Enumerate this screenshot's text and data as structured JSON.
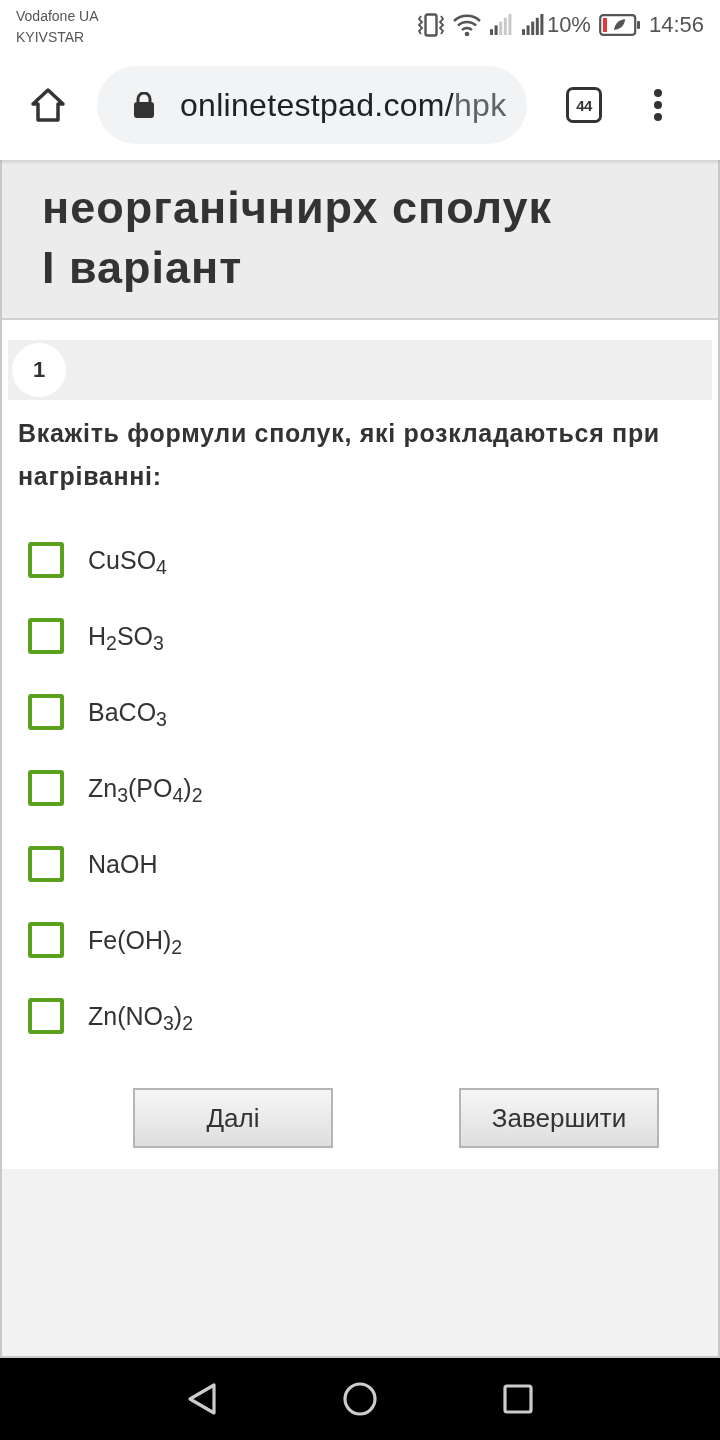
{
  "status_bar": {
    "carriers": [
      "Vodafone UA",
      "KYIVSTAR"
    ],
    "battery_text": "10%",
    "time": "14:56"
  },
  "browser": {
    "url_domain": "onlinetestpad.com/",
    "url_path": "hpk",
    "tab_count": "44"
  },
  "test": {
    "title_lines": [
      "неорганічнирх сполук",
      "І варіант"
    ],
    "question": {
      "number": "1",
      "text": "Вкажіть формули сполук, які розкладаються при нагріванні:",
      "options": [
        {
          "label": "CuSO$_{4}$",
          "checked": false
        },
        {
          "label": "H$_{2}$SO$_{3}$",
          "checked": false
        },
        {
          "label": "BaCO$_{3}$",
          "checked": false
        },
        {
          "label": "Zn$_{3}$(PO$_{4}$)$_{2}$",
          "checked": false
        },
        {
          "label": "NaOH",
          "checked": false
        },
        {
          "label": "Fe(OH)$_{2}$",
          "checked": false
        },
        {
          "label": "Zn(NO$_{3}$)$_{2}$",
          "checked": false
        }
      ]
    },
    "buttons": [
      "Далі",
      "Завершити"
    ]
  }
}
